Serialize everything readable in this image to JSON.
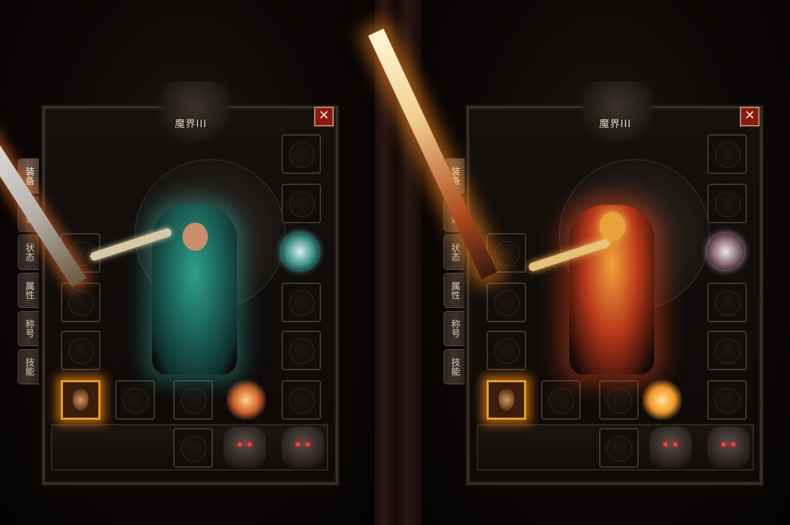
{
  "panels": [
    {
      "title": "魔界III",
      "close_label": "✕",
      "tabs": [
        "装备",
        "时装",
        "状态",
        "属性",
        "称号",
        "技能"
      ],
      "active_tab": "装备"
    },
    {
      "title": "魔界III",
      "close_label": "✕",
      "tabs": [
        "装备",
        "时装",
        "状态",
        "属性",
        "称号",
        "技能"
      ],
      "active_tab": "装备"
    }
  ],
  "colors": {
    "accent": "#e3a125",
    "close": "#8a1b12",
    "frame": "#3b2f28"
  },
  "icons": {
    "close": "close-icon",
    "slot": "pentagram-slot-icon",
    "helmet": "helmet-icon",
    "skull": "demon-skull-icon"
  }
}
